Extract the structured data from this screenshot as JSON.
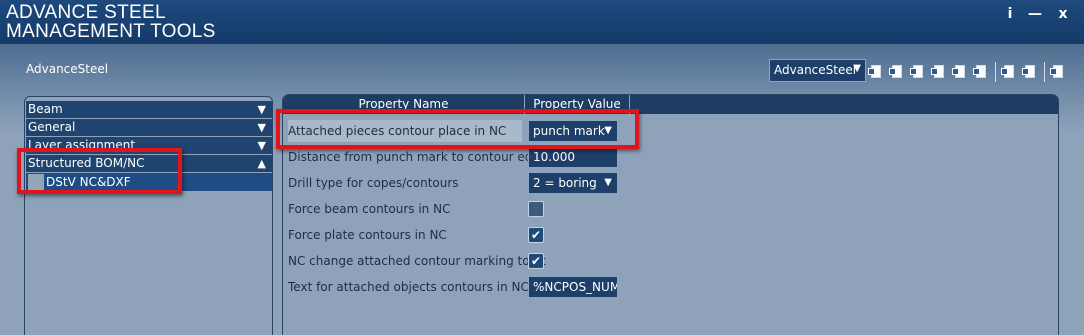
{
  "window": {
    "title_line1": "ADVANCE STEEL",
    "title_line2": "MANAGEMENT TOOLS",
    "info_label": "i",
    "minimize_label": "—",
    "close_label": "x"
  },
  "app_label": "AdvanceSteel",
  "toolbar": {
    "profile_select": "AdvanceSteel",
    "icons": [
      "copy-icon",
      "paste-icon",
      "import-icon",
      "export-icon",
      "tag-icon",
      "refresh-icon",
      "save-icon",
      "delete-icon",
      "properties-icon"
    ]
  },
  "tree": {
    "items": [
      {
        "label": "Beam",
        "state": "collapsed"
      },
      {
        "label": "General",
        "state": "collapsed"
      },
      {
        "label": "Layer assignment",
        "state": "collapsed"
      },
      {
        "label": "Structured BOM/NC",
        "state": "expanded"
      }
    ],
    "selected_child": "DStV NC&DXF"
  },
  "table": {
    "col_name": "Property Name",
    "col_value": "Property Value",
    "rows": [
      {
        "name": "Attached pieces contour place in NC",
        "type": "select",
        "value": "punch mark"
      },
      {
        "name": "Distance from punch mark to contour edge",
        "type": "text",
        "value": "10.000"
      },
      {
        "name": "Drill type for copes/contours",
        "type": "select",
        "value": "2 = boring"
      },
      {
        "name": "Force beam contours in NC",
        "type": "checkbox",
        "checked": false
      },
      {
        "name": "Force plate contours in NC",
        "type": "checkbox",
        "checked": true
      },
      {
        "name": "NC change attached contour marking to fit",
        "type": "checkbox",
        "checked": true
      },
      {
        "name": "Text for attached objects contours in NC",
        "type": "text",
        "value": "%NCPOS_NUM"
      }
    ]
  },
  "colors": {
    "titlebar": "#1e4a7e",
    "highlight": "#e0141a",
    "selection": "#1e4c85"
  }
}
